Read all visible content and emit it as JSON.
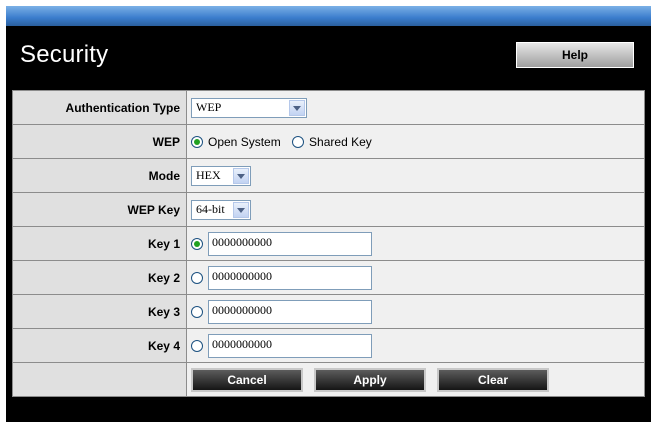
{
  "header": {
    "title": "Security",
    "help_label": "Help"
  },
  "form": {
    "auth_type": {
      "label": "Authentication Type",
      "value": "WEP"
    },
    "wep": {
      "label": "WEP",
      "option_open": "Open System",
      "option_shared": "Shared Key",
      "selected": "Open System"
    },
    "mode": {
      "label": "Mode",
      "value": "HEX"
    },
    "wep_key": {
      "label": "WEP Key",
      "value": "64-bit"
    },
    "keys": [
      {
        "label": "Key 1",
        "value": "0000000000",
        "selected": true
      },
      {
        "label": "Key 2",
        "value": "0000000000",
        "selected": false
      },
      {
        "label": "Key 3",
        "value": "0000000000",
        "selected": false
      },
      {
        "label": "Key 4",
        "value": "0000000000",
        "selected": false
      }
    ]
  },
  "buttons": {
    "cancel": "Cancel",
    "apply": "Apply",
    "clear": "Clear"
  },
  "colors": {
    "accent_bar": "#3a7ccc",
    "background": "#000000",
    "radio_dot": "#21a121"
  }
}
